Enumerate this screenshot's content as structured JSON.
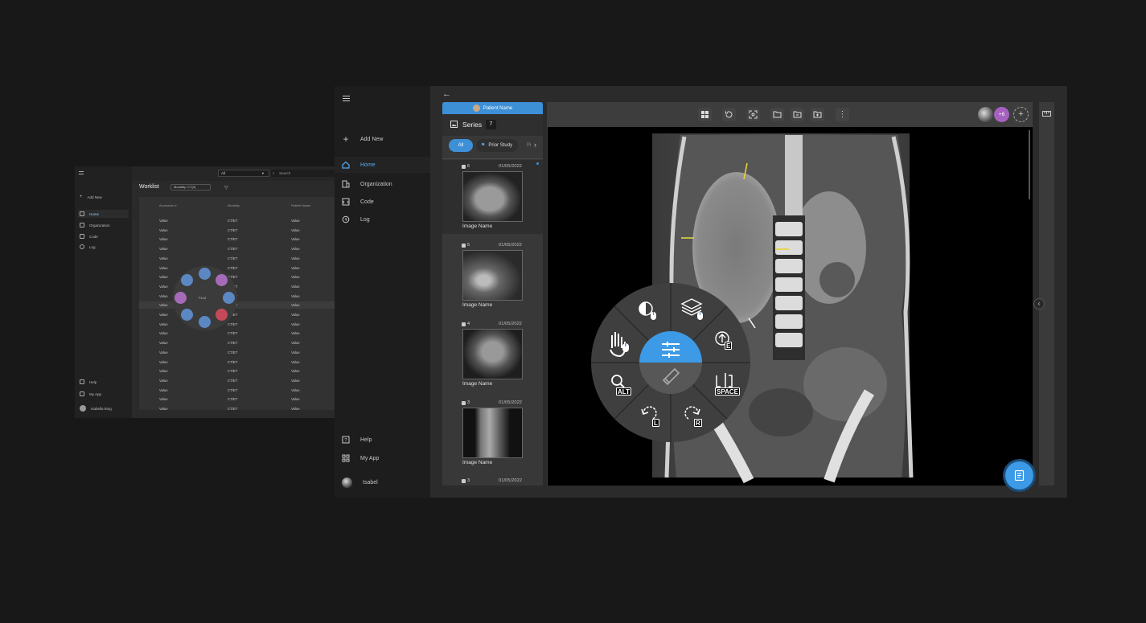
{
  "mini_app": {
    "nav": [
      "Add New",
      "Home",
      "Organization",
      "Code",
      "Log"
    ],
    "nav_bottom": [
      "Help",
      "My App"
    ],
    "user": "Isabella Bing",
    "filter_value": "All",
    "search_placeholder": "Search",
    "title": "Worklist",
    "chip": "Modality: CT(3)",
    "columns": [
      "Accession #",
      "Modality",
      "Patient Name"
    ],
    "cell_value": "Value",
    "cell_modality": "CT/ET",
    "wheel_center": "FILM"
  },
  "sidebar": {
    "items": [
      {
        "label": "Add New",
        "icon": "plus-icon"
      },
      {
        "label": "Home",
        "icon": "home-icon"
      },
      {
        "label": "Organization",
        "icon": "building-icon"
      },
      {
        "label": "Code",
        "icon": "code-icon"
      },
      {
        "label": "Log",
        "icon": "history-icon"
      }
    ],
    "bottom": [
      {
        "label": "Help",
        "icon": "help-icon"
      },
      {
        "label": "My App",
        "icon": "apps-icon"
      }
    ],
    "user": "Isabel",
    "active_color": "#4a9de6"
  },
  "patient": {
    "name": "Patient Name"
  },
  "series_panel": {
    "title": "Series",
    "count": "7",
    "filters": [
      "All",
      "Prior Study",
      "Pi"
    ],
    "thumbs": [
      {
        "num": "6",
        "date": "01/05/2022",
        "name": "Image Name"
      },
      {
        "num": "5",
        "date": "01/05/2022",
        "name": "Image Name"
      },
      {
        "num": "4",
        "date": "01/05/2022",
        "name": "Image Name"
      },
      {
        "num": "3",
        "date": "01/05/2022",
        "name": "Image Name"
      },
      {
        "num": "3",
        "date": "01/05/2022",
        "name": ""
      }
    ]
  },
  "viewer": {
    "avatars_extra": "+6",
    "accent": "#3d9ae6",
    "avatar_color": "#a661c0"
  },
  "radial_menu": {
    "keys": {
      "e": "E",
      "alt": "ALT",
      "space": "SPACE",
      "l": "L",
      "r": "R"
    },
    "center_color": "#3d9ae6"
  }
}
